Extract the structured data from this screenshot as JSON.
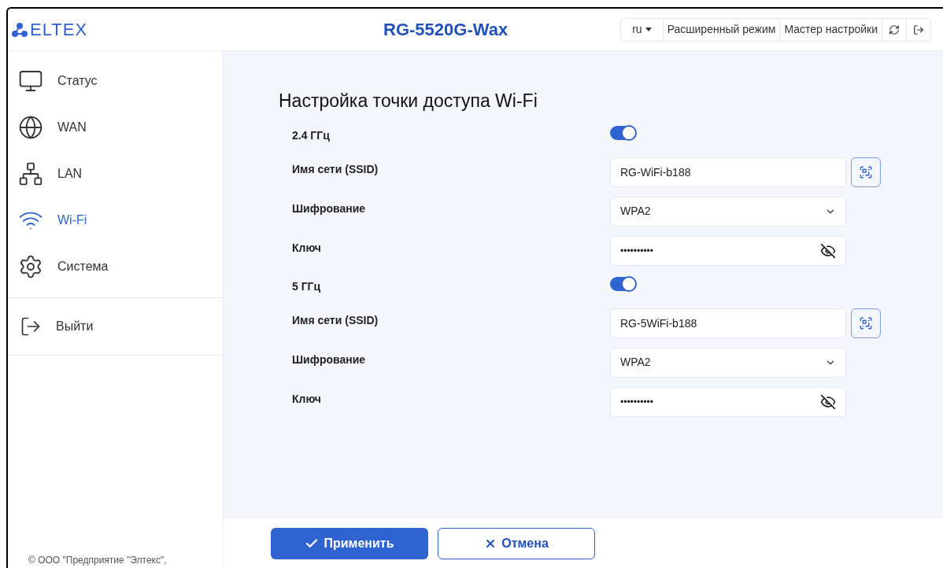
{
  "header": {
    "logo": "ELTEX",
    "title": "RG-5520G-Wax",
    "language": "ru",
    "links": [
      "Расширенный режим",
      "Мастер настройки"
    ]
  },
  "sidebar": {
    "items": [
      {
        "label": "Статус",
        "kind": "monitor",
        "selected": false
      },
      {
        "label": "WAN",
        "kind": "globe",
        "selected": false
      },
      {
        "label": "LAN",
        "kind": "network",
        "selected": false
      },
      {
        "label": "Wi-Fi",
        "kind": "wifi",
        "selected": true
      },
      {
        "label": "Система",
        "kind": "gear",
        "selected": false
      }
    ],
    "logout": "Выйти",
    "copyright": "© ООО \"Предприятие \"Элтекс\","
  },
  "page_title": "Настройка точки доступа Wi-Fi",
  "bands": [
    {
      "label": "2.4 ГГц",
      "on": true,
      "fields": [
        {
          "kind": "text",
          "label": "Имя сети (SSID)",
          "value": "RG-WiFi-b188"
        },
        {
          "kind": "select",
          "label": "Шифрование",
          "value": "WPA2"
        },
        {
          "kind": "password",
          "label": "Ключ",
          "value": "••••••••••"
        }
      ]
    },
    {
      "label": "5 ГГц",
      "on": true,
      "fields": [
        {
          "kind": "text",
          "label": "Имя сети (SSID)",
          "value": "RG-5WiFi-b188"
        },
        {
          "kind": "select",
          "label": "Шифрование",
          "value": "WPA2"
        },
        {
          "kind": "password",
          "label": "Ключ",
          "value": "••••••••••"
        }
      ]
    }
  ],
  "buttons": {
    "apply": "Применить",
    "cancel": "Отмена"
  }
}
